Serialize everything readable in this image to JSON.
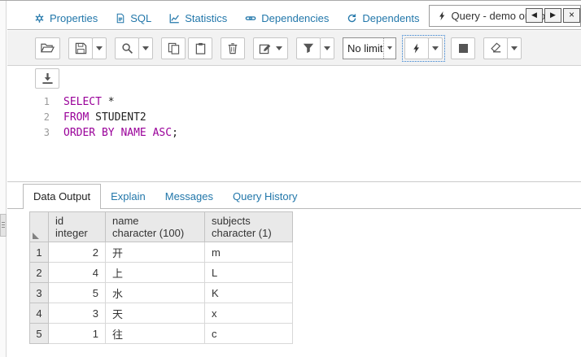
{
  "colors": {
    "link_blue": "#2277aa",
    "keyword": "#990099",
    "toolbar_bg": "#f2f2f2",
    "header_bg": "#e9e9e9"
  },
  "tab_bar": {
    "tabs": [
      {
        "label": "Properties"
      },
      {
        "label": "SQL"
      },
      {
        "label": "Statistics"
      },
      {
        "label": "Dependencies"
      },
      {
        "label": "Dependents"
      },
      {
        "label": "Query - demo on po",
        "active": true
      }
    ],
    "nav": {
      "back": "◀",
      "forward": "▶",
      "close": "×"
    }
  },
  "toolbar": {
    "row_limit": "No limit"
  },
  "editor": {
    "lines": [
      {
        "number": "1",
        "tokens": [
          {
            "type": "keyword",
            "text": "SELECT"
          },
          {
            "type": "plain",
            "text": " *"
          }
        ]
      },
      {
        "number": "2",
        "tokens": [
          {
            "type": "keyword",
            "text": "FROM"
          },
          {
            "type": "plain",
            "text": " STUDENT2"
          }
        ]
      },
      {
        "number": "3",
        "tokens": [
          {
            "type": "keyword",
            "text": "ORDER BY NAME ASC"
          },
          {
            "type": "plain",
            "text": ";"
          }
        ]
      }
    ]
  },
  "results": {
    "tabs": [
      {
        "label": "Data Output",
        "active": true
      },
      {
        "label": "Explain"
      },
      {
        "label": "Messages"
      },
      {
        "label": "Query History"
      }
    ],
    "columns": [
      {
        "name": "id",
        "type": "integer"
      },
      {
        "name": "name",
        "type": "character (100)"
      },
      {
        "name": "subjects",
        "type": "character (1)"
      }
    ],
    "rows": [
      {
        "row_num": "1",
        "cells": [
          "2",
          "开",
          "m"
        ]
      },
      {
        "row_num": "2",
        "cells": [
          "4",
          "上",
          "L"
        ]
      },
      {
        "row_num": "3",
        "cells": [
          "5",
          "水",
          "K"
        ]
      },
      {
        "row_num": "4",
        "cells": [
          "3",
          "天",
          "x"
        ]
      },
      {
        "row_num": "5",
        "cells": [
          "1",
          "往",
          "c"
        ]
      }
    ]
  },
  "icons": {
    "properties-icon": "gear",
    "sql-icon": "file-code",
    "statistics-icon": "line-chart",
    "dependencies-icon": "chain-link",
    "dependents-icon": "circular-arrow",
    "query-icon": "lightning-bolt",
    "open-file-icon": "folder-open",
    "save-icon": "floppy-disk",
    "find-icon": "magnifier",
    "copy-icon": "two-pages",
    "paste-icon": "clipboard",
    "delete-icon": "trash-can",
    "edit-icon": "pencil-square",
    "filter-icon": "funnel",
    "execute-icon": "lightning-bolt",
    "stop-icon": "filled-square",
    "clear-icon": "eraser",
    "save-results-icon": "download-tray",
    "caret-down-icon": "▾",
    "back-icon": "◀",
    "forward-icon": "▶",
    "close-icon": "×",
    "sort-corner-icon": "corner-triangle"
  }
}
